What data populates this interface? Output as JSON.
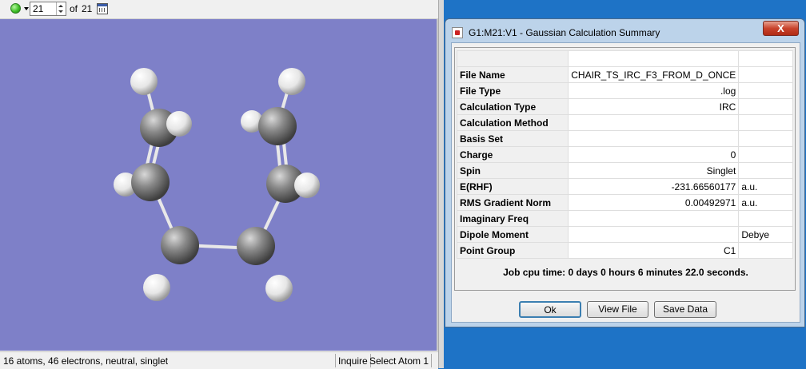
{
  "toolbar": {
    "frame_value": "21",
    "of_label": "of",
    "total_frames": "21"
  },
  "status": {
    "text": "16 atoms, 46 electrons, neutral, singlet",
    "inquire": "Inquire",
    "select_atom": "Select Atom 1"
  },
  "dialog": {
    "title": "G1:M21:V1 - Gaussian Calculation Summary",
    "close_label": "X",
    "rows": [
      {
        "label": "File Name",
        "value": "CHAIR_TS_IRC_F3_FROM_D_ONCE",
        "unit": ""
      },
      {
        "label": "File Type",
        "value": ".log",
        "unit": ""
      },
      {
        "label": "Calculation Type",
        "value": "IRC",
        "unit": ""
      },
      {
        "label": "Calculation Method",
        "value": "",
        "unit": ""
      },
      {
        "label": "Basis Set",
        "value": "",
        "unit": ""
      },
      {
        "label": "Charge",
        "value": "0",
        "unit": ""
      },
      {
        "label": "Spin",
        "value": "Singlet",
        "unit": ""
      },
      {
        "label": "E(RHF)",
        "value": "-231.66560177",
        "unit": "a.u."
      },
      {
        "label": "RMS Gradient Norm",
        "value": "0.00492971",
        "unit": "a.u."
      },
      {
        "label": "Imaginary Freq",
        "value": "",
        "unit": ""
      },
      {
        "label": "Dipole Moment",
        "value": "",
        "unit": "Debye"
      },
      {
        "label": "Point Group",
        "value": "C1",
        "unit": ""
      }
    ],
    "cpu_time": "Job cpu time:  0 days  0 hours  6 minutes 22.0 seconds.",
    "buttons": {
      "ok": "Ok",
      "view_file": "View File",
      "save_data": "Save Data"
    }
  },
  "colors": {
    "viewer_background": "#7e80c8",
    "desktop_background": "#1e73c6",
    "carbon": "#7a7a7a",
    "hydrogen": "#f2f2f2"
  }
}
